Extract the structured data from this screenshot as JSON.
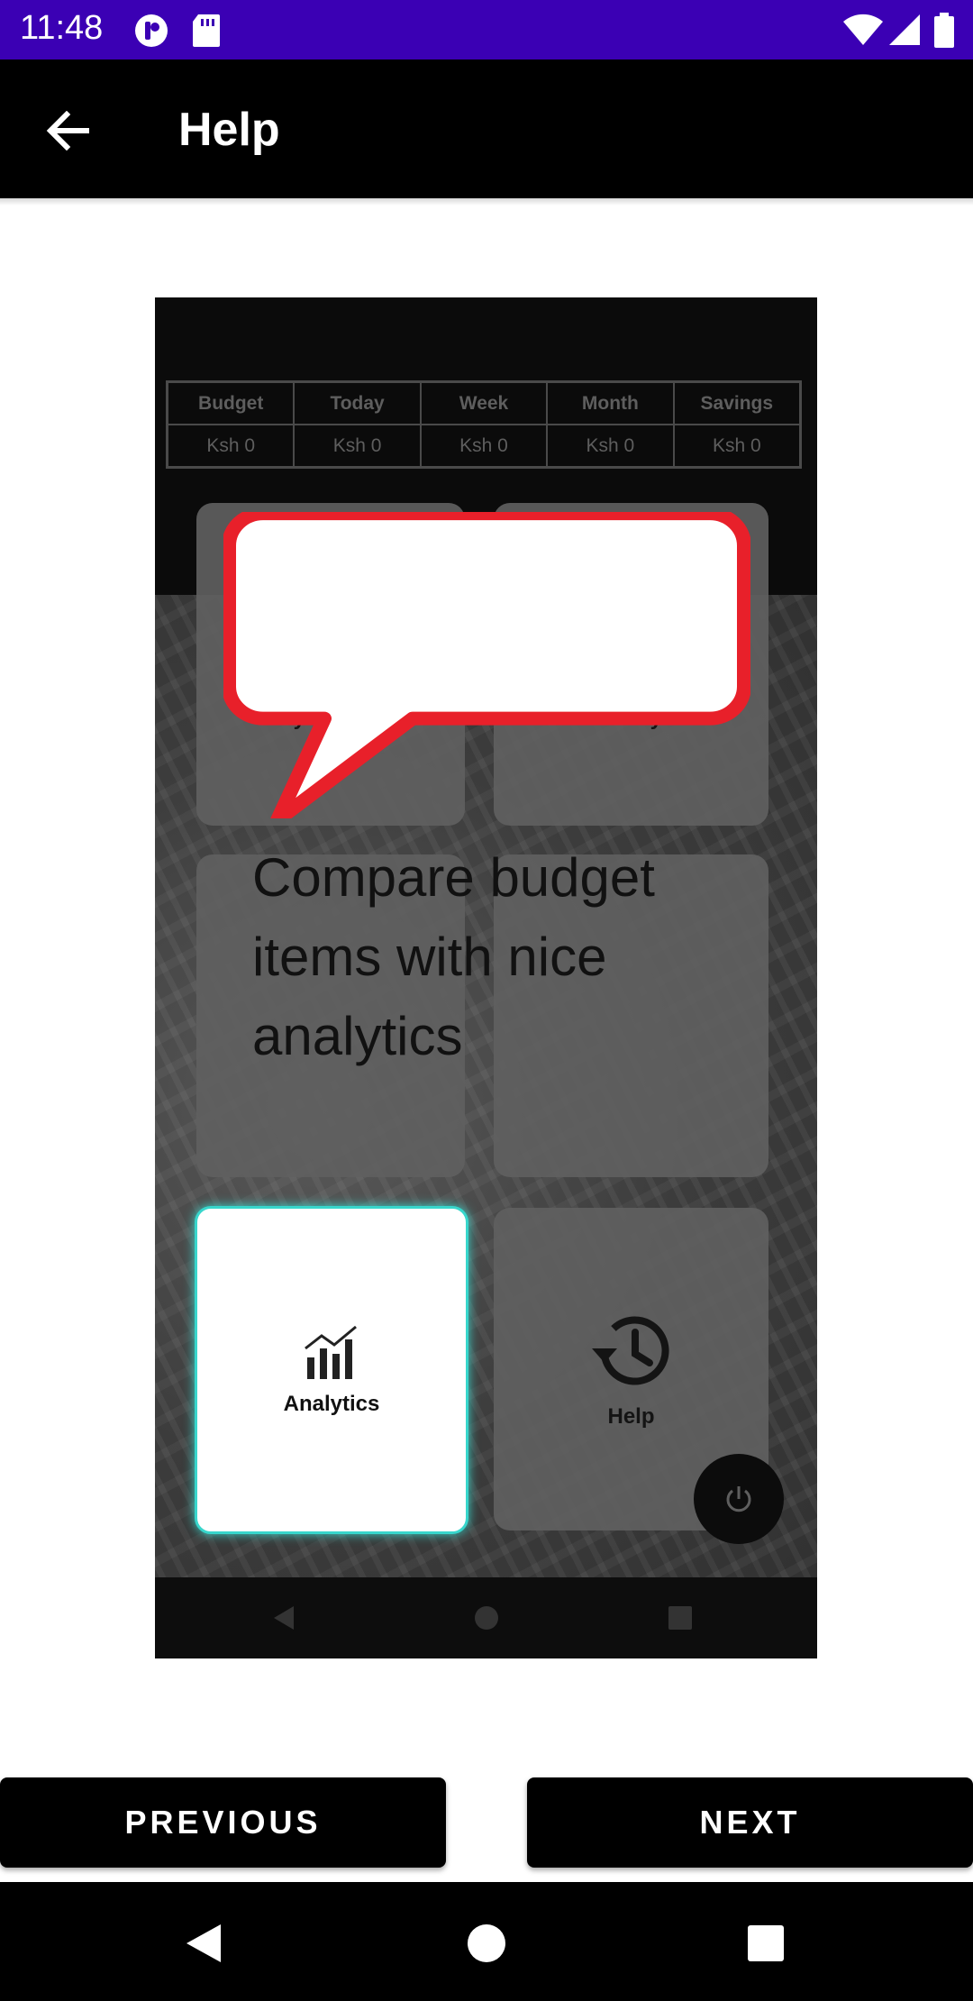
{
  "status_bar": {
    "time": "11:48"
  },
  "app_bar": {
    "title": "Help"
  },
  "help_image": {
    "table": {
      "headers": [
        "Budget",
        "Today",
        "Week",
        "Month",
        "Savings"
      ],
      "values": [
        "Ksh 0",
        "Ksh 0",
        "Ksh 0",
        "Ksh 0",
        "Ksh 0"
      ]
    },
    "tiles": {
      "my_budget": "My Budget",
      "today": "Today",
      "analytics": "Analytics",
      "help": "Help"
    },
    "callout": "Compare budget items with nice analytics"
  },
  "buttons": {
    "previous": "PREVIOUS",
    "next": "NEXT"
  },
  "colors": {
    "status_bar": "#3b00b4",
    "callout_border": "#e8202a",
    "highlight_border": "#38d6cc"
  }
}
